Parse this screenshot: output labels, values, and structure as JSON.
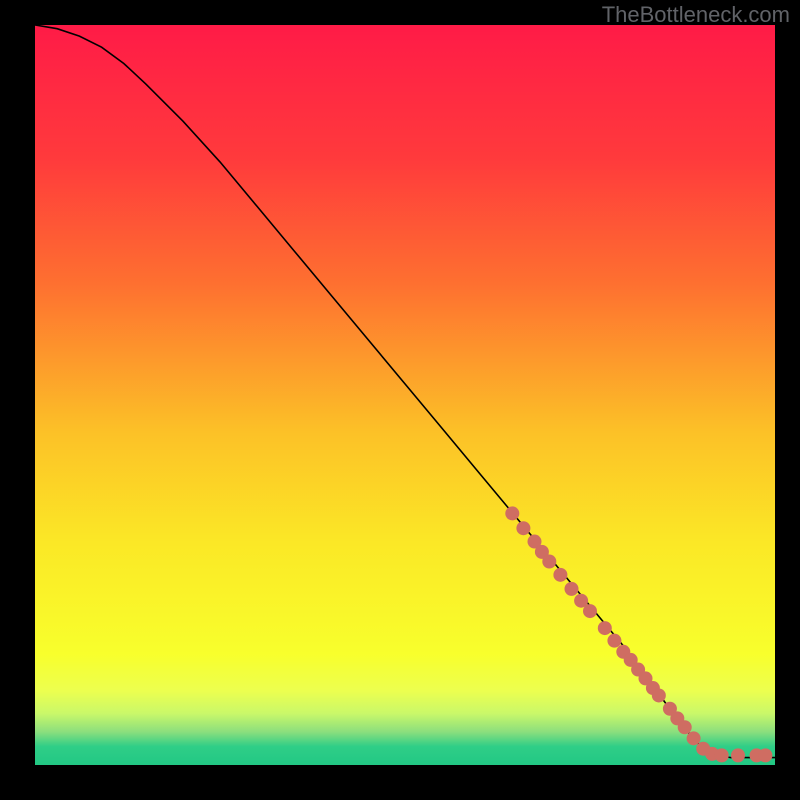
{
  "watermark": "TheBottleneck.com",
  "chart_data": {
    "type": "line",
    "title": "",
    "xlabel": "",
    "ylabel": "",
    "xlim": [
      0,
      100
    ],
    "ylim": [
      0,
      100
    ],
    "grid": false,
    "legend": false,
    "background_gradient": {
      "type": "vertical",
      "stops": [
        {
          "at": 0.0,
          "color": "#ff1b47"
        },
        {
          "at": 0.18,
          "color": "#ff3a3c"
        },
        {
          "at": 0.35,
          "color": "#fe7030"
        },
        {
          "at": 0.55,
          "color": "#fcc127"
        },
        {
          "at": 0.7,
          "color": "#fbe826"
        },
        {
          "at": 0.85,
          "color": "#f8ff2c"
        },
        {
          "at": 0.9,
          "color": "#ecff4f"
        },
        {
          "at": 0.93,
          "color": "#caf869"
        },
        {
          "at": 0.955,
          "color": "#8cdf7d"
        },
        {
          "at": 0.975,
          "color": "#2fce87"
        },
        {
          "at": 1.0,
          "color": "#22c884"
        }
      ]
    },
    "series": [
      {
        "name": "curve",
        "type": "line",
        "stroke": "#000000",
        "x": [
          0,
          3,
          6,
          9,
          12,
          15,
          20,
          25,
          30,
          35,
          40,
          45,
          50,
          55,
          60,
          65,
          70,
          75,
          80,
          82,
          84,
          86,
          88,
          90,
          92,
          94,
          96,
          98,
          100
        ],
        "y": [
          100,
          99.5,
          98.5,
          97,
          94.8,
          92,
          87,
          81.5,
          75.5,
          69.5,
          63.5,
          57.5,
          51.5,
          45.5,
          39.5,
          33.5,
          27.5,
          21.5,
          15.5,
          12.8,
          10.0,
          7.3,
          4.7,
          2.5,
          1.4,
          1.0,
          1.0,
          1.0,
          1.0
        ]
      },
      {
        "name": "points",
        "type": "scatter",
        "fill": "#cf6d62",
        "radius": 7,
        "x": [
          64.5,
          66.0,
          67.5,
          68.5,
          69.5,
          71.0,
          72.5,
          73.8,
          75.0,
          77.0,
          78.3,
          79.5,
          80.5,
          81.5,
          82.5,
          83.5,
          84.3,
          85.8,
          86.8,
          87.8,
          89.0,
          90.3,
          91.5,
          92.8,
          95.0,
          97.5,
          98.7
        ],
        "y": [
          34.0,
          32.0,
          30.2,
          28.8,
          27.5,
          25.7,
          23.8,
          22.2,
          20.8,
          18.5,
          16.8,
          15.3,
          14.2,
          12.9,
          11.7,
          10.4,
          9.4,
          7.6,
          6.3,
          5.1,
          3.6,
          2.2,
          1.5,
          1.3,
          1.3,
          1.3,
          1.3
        ]
      }
    ]
  }
}
